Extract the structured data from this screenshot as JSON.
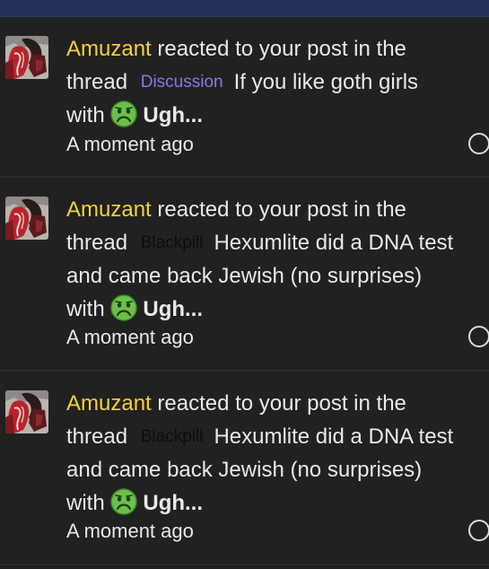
{
  "notifications": [
    {
      "user": "Amuzant",
      "action": "reacted to your post in the",
      "thread_word": "thread",
      "prefix": "Discussion",
      "prefix_color": "#8b77e8",
      "title_lines": [
        "If you like goth girls"
      ],
      "with_word": "with",
      "reaction_icon": "sick-face-icon",
      "reaction": "Ugh...",
      "time": "A moment ago"
    },
    {
      "user": "Amuzant",
      "action": "reacted to your post in the",
      "thread_word": "thread",
      "prefix": "Blackpill",
      "prefix_color": "#0d0d0d",
      "title_lines": [
        "Hexumlite did a DNA test",
        "and came back Jewish (no surprises)"
      ],
      "with_word": "with",
      "reaction_icon": "sick-face-icon",
      "reaction": "Ugh...",
      "time": "A moment ago"
    },
    {
      "user": "Amuzant",
      "action": "reacted to your post in the",
      "thread_word": "thread",
      "prefix": "Blackpill",
      "prefix_color": "#0d0d0d",
      "title_lines": [
        "Hexumlite did a DNA test",
        "and came back Jewish (no surprises)"
      ],
      "with_word": "with",
      "reaction_icon": "sick-face-icon",
      "reaction": "Ugh...",
      "time": "A moment ago"
    }
  ],
  "colors": {
    "username": "#f3d23a",
    "background": "#212121",
    "header": "#253158"
  }
}
